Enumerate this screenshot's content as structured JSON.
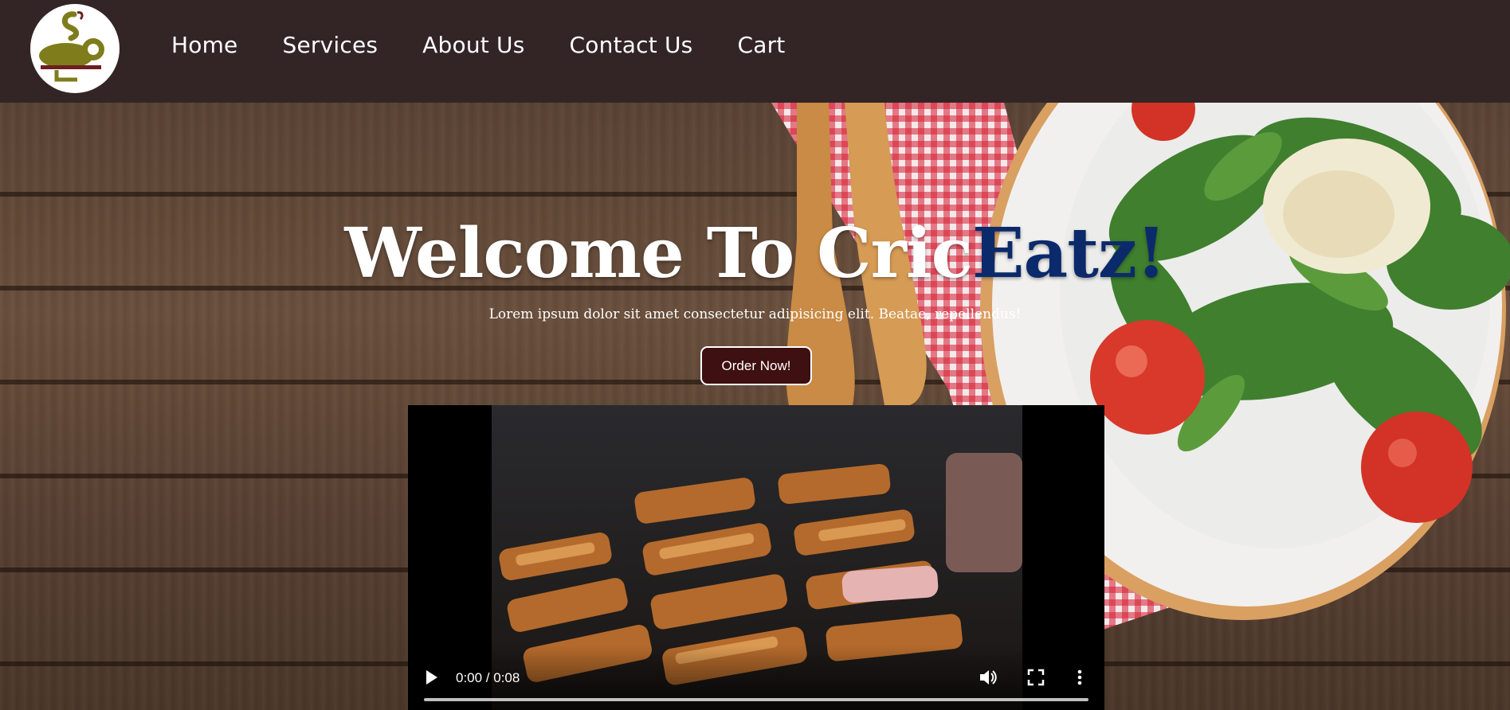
{
  "nav": {
    "items": [
      {
        "label": "Home"
      },
      {
        "label": "Services"
      },
      {
        "label": "About Us"
      },
      {
        "label": "Contact Us"
      },
      {
        "label": "Cart"
      }
    ]
  },
  "hero": {
    "title_main": "Welcome To Cric",
    "title_accent": "Eatz!",
    "subtitle": "Lorem ipsum dolor sit amet consectetur adipisicing elit. Beatae, repellendus!",
    "cta_label": "Order Now!"
  },
  "video": {
    "time": "0:00 / 0:08",
    "progress": 0
  },
  "colors": {
    "navbar_bg": "#332526",
    "accent_blue": "#0b2a6b",
    "button_bg": "#3e1011",
    "logo_green": "#7f7d1b",
    "logo_maroon": "#6b1f1f"
  },
  "icons": {
    "logo": "chef-logo-icon",
    "play": "play-icon",
    "volume": "volume-icon",
    "fullscreen": "fullscreen-icon",
    "more": "more-vert-icon"
  }
}
